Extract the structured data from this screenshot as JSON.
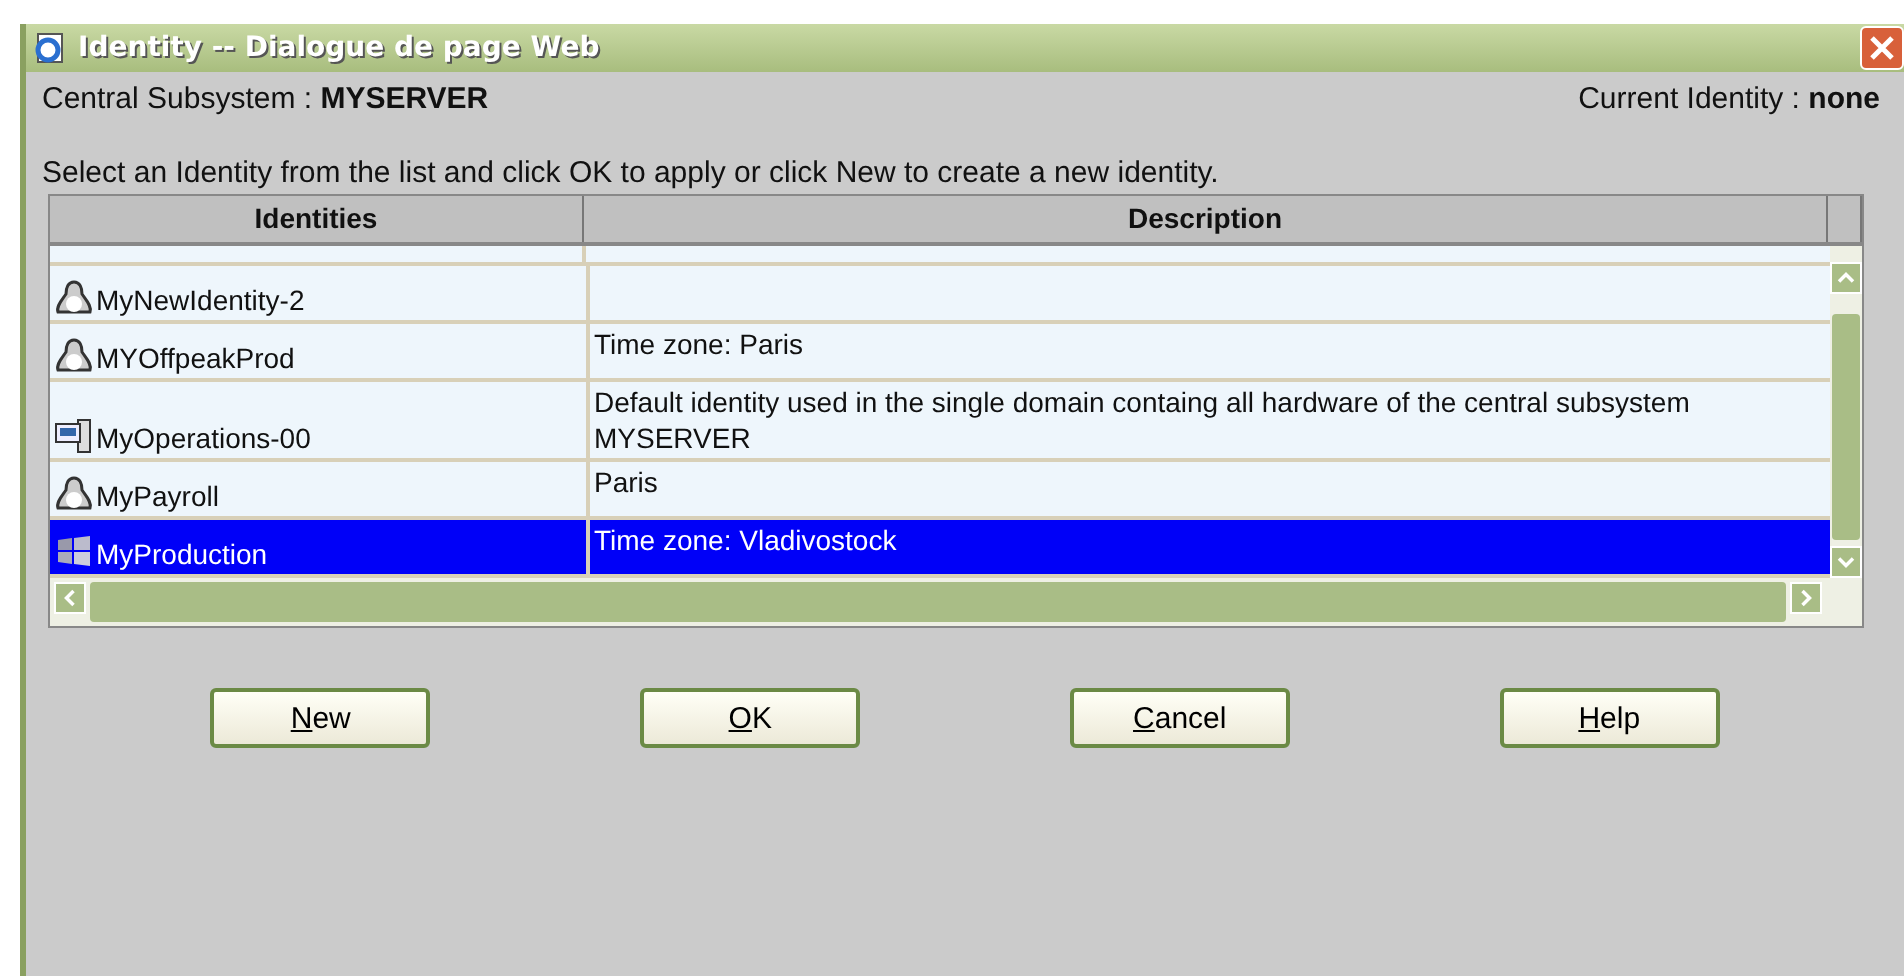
{
  "window": {
    "title": "Identity -- Dialogue de page Web"
  },
  "header": {
    "subsystem_label": "Central Subsystem :",
    "subsystem": "MYSERVER",
    "identity_label": "Current Identity :",
    "identity": "none"
  },
  "instruction": "Select an Identity from the list and click OK to apply or click New to create a new identity.",
  "table": {
    "columns": [
      "Identities",
      "Description"
    ],
    "rows": [
      {
        "name": "MyNewIdentity-2",
        "kind": "linux",
        "description": "",
        "selected": false
      },
      {
        "name": "MYOffpeakProd",
        "kind": "linux",
        "description": "Time zone: Paris",
        "selected": false
      },
      {
        "name": "MyOperations-00",
        "kind": "server",
        "description": "Default identity used in the single domain containg all hardware of the central subsystem MYSERVER",
        "selected": false
      },
      {
        "name": "MyPayroll",
        "kind": "linux",
        "description": "Paris",
        "selected": false
      },
      {
        "name": "MyProduction",
        "kind": "windows",
        "description": "Time zone: Vladivostock",
        "selected": true
      }
    ]
  },
  "buttons": [
    "New",
    "OK",
    "Cancel",
    "Help"
  ]
}
